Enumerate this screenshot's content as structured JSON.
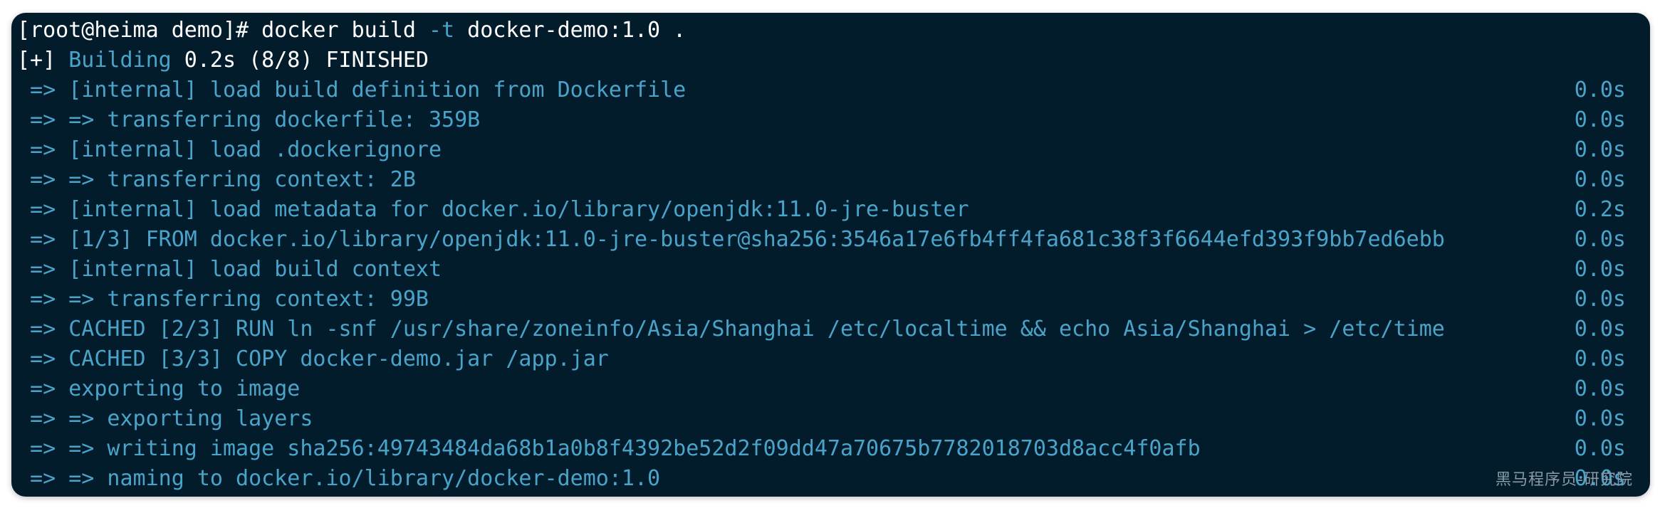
{
  "terminal": {
    "prompt": "[root@heima demo]# ",
    "command_pre": "docker build ",
    "command_flag": "-t",
    "command_post": " docker-demo:1.0 .",
    "status_prefix": "[+] ",
    "status_word": "Building",
    "status_rest": " 0.2s (8/8) FINISHED",
    "lines": [
      {
        "text": " => [internal] load build definition from Dockerfile",
        "time": "0.0s"
      },
      {
        "text": " => => transferring dockerfile: 359B",
        "time": "0.0s"
      },
      {
        "text": " => [internal] load .dockerignore",
        "time": "0.0s"
      },
      {
        "text": " => => transferring context: 2B",
        "time": "0.0s"
      },
      {
        "text": " => [internal] load metadata for docker.io/library/openjdk:11.0-jre-buster",
        "time": "0.2s"
      },
      {
        "text": " => [1/3] FROM docker.io/library/openjdk:11.0-jre-buster@sha256:3546a17e6fb4ff4fa681c38f3f6644efd393f9bb7ed6ebb",
        "time": "0.0s"
      },
      {
        "text": " => [internal] load build context",
        "time": "0.0s"
      },
      {
        "text": " => => transferring context: 99B",
        "time": "0.0s"
      },
      {
        "text": " => CACHED [2/3] RUN ln -snf /usr/share/zoneinfo/Asia/Shanghai /etc/localtime && echo Asia/Shanghai > /etc/time",
        "time": "0.0s"
      },
      {
        "text": " => CACHED [3/3] COPY docker-demo.jar /app.jar",
        "time": "0.0s"
      },
      {
        "text": " => exporting to image",
        "time": "0.0s"
      },
      {
        "text": " => => exporting layers",
        "time": "0.0s"
      },
      {
        "text": " => => writing image sha256:49743484da68b1a0b8f4392be52d2f09dd47a70675b7782018703d8acc4f0afb",
        "time": "0.0s"
      },
      {
        "text": " => => naming to docker.io/library/docker-demo:1.0",
        "time": "0.0s"
      }
    ]
  },
  "watermark": "黑马程序员-研究院",
  "colors": {
    "background": "#031c2c",
    "text": "#ffffff",
    "step": "#4aa3c8"
  }
}
